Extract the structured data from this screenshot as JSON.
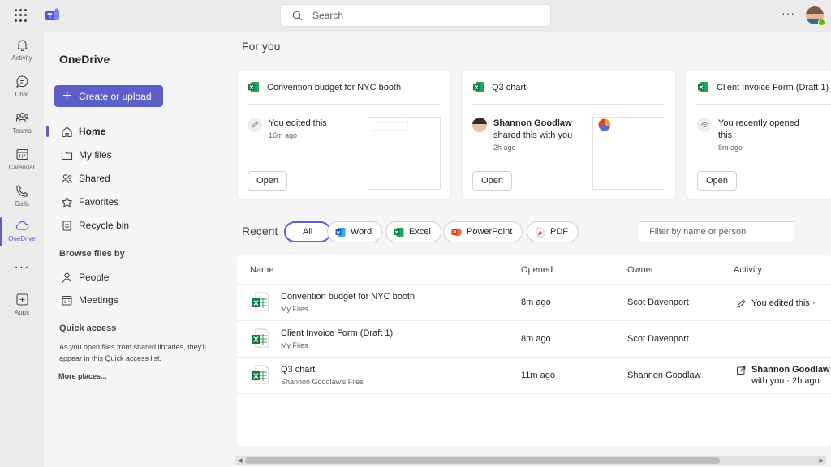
{
  "topbar": {
    "search_placeholder": "Search",
    "more_label": "···"
  },
  "rail": {
    "items": [
      {
        "label": "Activity",
        "icon": "bell-icon"
      },
      {
        "label": "Chat",
        "icon": "chat-icon"
      },
      {
        "label": "Teams",
        "icon": "teams-icon"
      },
      {
        "label": "Calendar",
        "icon": "calendar-icon"
      },
      {
        "label": "Calls",
        "icon": "phone-icon"
      },
      {
        "label": "OneDrive",
        "icon": "cloud-icon"
      },
      {
        "label": "Apps",
        "icon": "add-app-icon"
      }
    ],
    "more_label": "···"
  },
  "sidepanel": {
    "title": "OneDrive",
    "create_label": "Create or upload",
    "nav": [
      {
        "label": "Home",
        "icon": "home-icon"
      },
      {
        "label": "My files",
        "icon": "folder-icon"
      },
      {
        "label": "Shared",
        "icon": "people-icon"
      },
      {
        "label": "Favorites",
        "icon": "star-icon"
      },
      {
        "label": "Recycle bin",
        "icon": "trash-icon"
      }
    ],
    "browse_heading": "Browse files by",
    "browse": [
      {
        "label": "People",
        "icon": "person-icon"
      },
      {
        "label": "Meetings",
        "icon": "meetings-icon"
      }
    ],
    "quick_access_heading": "Quick access",
    "quick_access_desc": "As you open files from shared libraries, they'll appear in this Quick access list.",
    "more_places": "More places..."
  },
  "main": {
    "for_you_title": "For you",
    "cards": [
      {
        "title": "Convention budget for NYC booth",
        "line1": "You edited this",
        "line2": "",
        "time": "16m ago",
        "open_label": "Open"
      },
      {
        "title": "Q3 chart",
        "line1": "Shannon Goodlaw",
        "line2": "shared this with you",
        "time": "2h ago",
        "open_label": "Open"
      },
      {
        "title": "Client Invoice Form (Draft 1)",
        "line1": "You recently opened",
        "line2": "this",
        "time": "8m ago",
        "open_label": "Open"
      }
    ],
    "recent_title": "Recent",
    "filters": [
      "All",
      "Word",
      "Excel",
      "PowerPoint",
      "PDF"
    ],
    "filter_placeholder": "Filter by name or person",
    "columns": [
      "Name",
      "Opened",
      "Owner",
      "Activity"
    ],
    "rows": [
      {
        "name": "Convention budget for NYC booth",
        "location": "My Files",
        "opened": "8m ago",
        "owner": "Scot Davenport",
        "activity_bold": "",
        "activity": "You edited this ·"
      },
      {
        "name": "Client Invoice Form (Draft 1)",
        "location": "My Files",
        "opened": "8m ago",
        "owner": "Scot Davenport",
        "activity_bold": "",
        "activity": ""
      },
      {
        "name": "Q3 chart",
        "location": "Shannon Goodlaw's Files",
        "opened": "11m ago",
        "owner": "Shannon Goodlaw",
        "activity_bold": "Shannon Goodlaw",
        "activity": "with you · 2h ago"
      }
    ]
  },
  "colors": {
    "accent": "#5b5fc7",
    "excel_green": "#107c41",
    "word_blue": "#185abd",
    "ppt_orange": "#c43e1c",
    "pdf_red": "#d13438"
  }
}
